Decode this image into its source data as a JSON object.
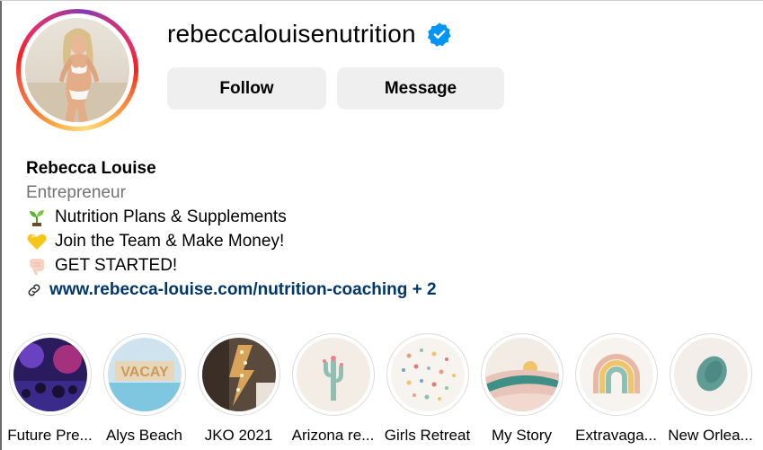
{
  "profile": {
    "username": "rebeccalouisenutrition",
    "verified": true
  },
  "actions": {
    "follow_label": "Follow",
    "message_label": "Message"
  },
  "bio": {
    "full_name": "Rebecca Louise",
    "category": "Entrepreneur",
    "lines": [
      {
        "icon": "seedling-icon",
        "text": "Nutrition Plans & Supplements"
      },
      {
        "icon": "yellow-heart-icon",
        "text": "Join the Team & Make Money!"
      },
      {
        "icon": "pointing-hand-icon",
        "text": "GET STARTED!"
      }
    ],
    "link_text": "www.rebecca-louise.com/nutrition-coaching + 2"
  },
  "highlights": [
    {
      "label": "Future Pre..."
    },
    {
      "label": "Alys Beach"
    },
    {
      "label": "JKO 2021"
    },
    {
      "label": "Arizona re..."
    },
    {
      "label": "Girls Retreat"
    },
    {
      "label": "My Story"
    },
    {
      "label": "Extravaga..."
    },
    {
      "label": "New Orlea..."
    }
  ],
  "colors": {
    "verified_blue": "#0095f6",
    "link_blue": "#00376b",
    "button_bg": "#efefef",
    "muted_text": "#737373"
  }
}
